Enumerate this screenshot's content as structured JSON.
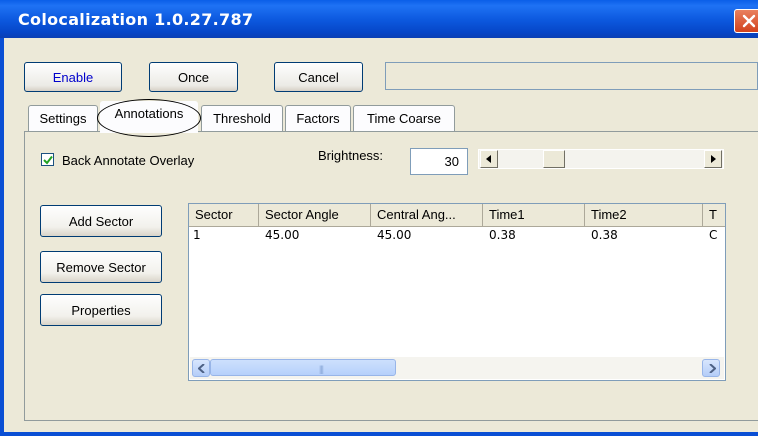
{
  "window": {
    "title": "Colocalization 1.0.27.787"
  },
  "toolbar": {
    "enable_label": "Enable",
    "once_label": "Once",
    "cancel_label": "Cancel",
    "status_text": ""
  },
  "tabs": [
    {
      "label": "Settings"
    },
    {
      "label": "Annotations"
    },
    {
      "label": "Threshold"
    },
    {
      "label": "Factors"
    },
    {
      "label": "Time Coarse"
    }
  ],
  "annotations": {
    "back_annotate_label": "Back Annotate Overlay",
    "back_annotate_checked": true,
    "brightness_label": "Brightness:",
    "brightness_value": "30",
    "brightness_level_fraction": 0.3,
    "add_sector_label": "Add Sector",
    "remove_sector_label": "Remove Sector",
    "properties_label": "Properties"
  },
  "grid": {
    "columns": [
      "Sector",
      "Sector Angle",
      "Central Ang...",
      "Time1",
      "Time2",
      "T"
    ],
    "rows": [
      [
        "1",
        "45.00",
        "45.00",
        "0.38",
        "0.38",
        "C"
      ]
    ]
  },
  "colors": {
    "titlebar": "#0a5ee8",
    "window_bg": "#ece9d8",
    "enable_text": "#0000cc",
    "close_button": "#d2421c"
  },
  "icons": [
    "close-icon",
    "check-icon",
    "arrow-left-icon",
    "arrow-right-icon"
  ]
}
